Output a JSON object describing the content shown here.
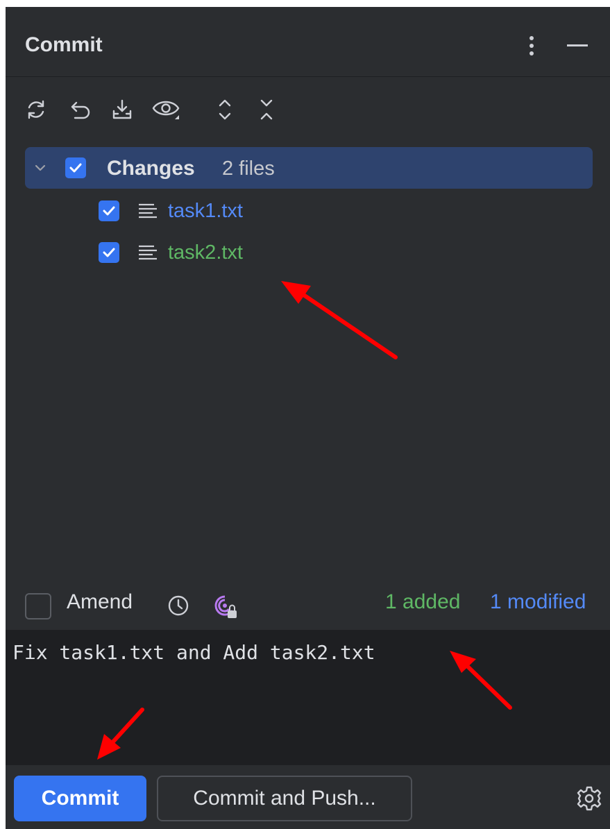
{
  "panel": {
    "title": "Commit",
    "menu_icon": "more-vertical-icon",
    "minimize_icon": "minimize-icon"
  },
  "toolbar": {
    "icons": [
      "refresh-icon",
      "rollback-icon",
      "shelve-icon",
      "preview-icon",
      "expand-all-icon",
      "collapse-all-icon"
    ]
  },
  "changes": {
    "group_label": "Changes",
    "group_count": "2 files",
    "files": [
      {
        "name": "task1.txt",
        "color": "#548af7",
        "status": "modified"
      },
      {
        "name": "task2.txt",
        "color": "#5fb865",
        "status": "added"
      }
    ]
  },
  "options": {
    "amend_label": "Amend",
    "history_icon": "history-icon",
    "ai_icon": "ai-assistant-locked-icon",
    "added_summary": "1 added",
    "modified_summary": "1 modified"
  },
  "message": {
    "text": "Fix task1.txt and Add task2.txt"
  },
  "actions": {
    "commit_label": "Commit",
    "commit_push_label": "Commit and Push...",
    "settings_icon": "gear-icon"
  },
  "colors": {
    "accent": "#3574f0",
    "panel_bg": "#2b2d30",
    "selection_bg": "#2e436e",
    "annotation_arrow": "#ff0000"
  }
}
